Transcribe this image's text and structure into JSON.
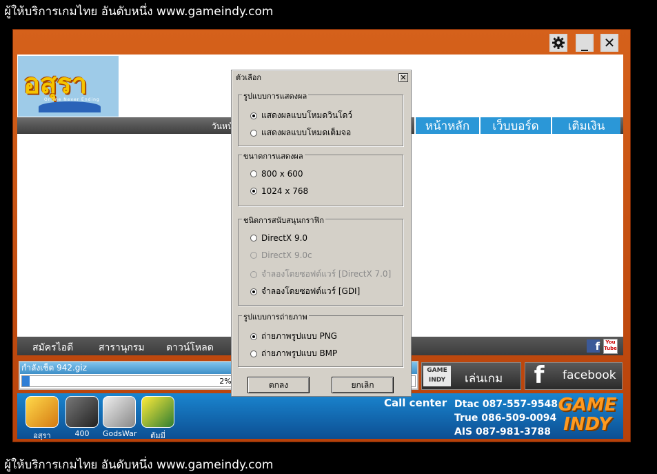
{
  "caption": "ผู้ให้บริการเกมไทย อันดับหนึ่ง www.gameindy.com",
  "titlebar": {
    "settings_icon": "gear-icon",
    "minimize_glyph": "_",
    "close_glyph": "✕"
  },
  "logo": {
    "title": "อสุรา",
    "subtitle": "Online Never Ending"
  },
  "nav": {
    "date_prefix": "วันหน้",
    "home": "หน้าหลัก",
    "board": "เว็บบอร์ด",
    "topup": "เติมเงิน"
  },
  "bottom_nav": {
    "register": "สมัครไอดี",
    "help": "สารานุกรม",
    "download": "ดาวน์โหลด",
    "facebook_glyph": "f",
    "youtube": "You Tube"
  },
  "status": {
    "text": "กำลังเช็ต 942.giz",
    "progress_label": "2%",
    "progress_fraction": 0.02
  },
  "play": {
    "label": "เล่นเกม",
    "logo": "GAME INDY"
  },
  "facebook": {
    "label": "facebook",
    "glyph": "f"
  },
  "banner": {
    "games": [
      {
        "name": "อสุรา"
      },
      {
        "name": "400"
      },
      {
        "name": "GodsWar"
      },
      {
        "name": "ตัมมี่"
      }
    ],
    "callcenter": "Call center",
    "phones": {
      "dtac": "Dtac  087-557-9548",
      "true": "True  086-509-0094",
      "ais": "AIS   087-981-3788"
    },
    "logo": "GAME INDY"
  },
  "dialog": {
    "title": "ตัวเลือก",
    "close_glyph": "✕",
    "groups": {
      "mode": {
        "title": "รูปแบบการแสดงผล",
        "options": [
          {
            "label": "แสดงผลแบบโหมดวินโดว์",
            "checked": true
          },
          {
            "label": "แสดงผลแบบโหมดเต็มจอ",
            "checked": false
          }
        ]
      },
      "res": {
        "title": "ขนาดการแสดงผล",
        "options": [
          {
            "label": "800 x 600",
            "checked": false
          },
          {
            "label": "1024 x 768",
            "checked": true
          }
        ]
      },
      "render": {
        "title": "ชนิดการสนับสนุนกราฟิก",
        "options": [
          {
            "label": "DirectX 9.0",
            "checked": false,
            "disabled": false
          },
          {
            "label": "DirectX 9.0c",
            "checked": false,
            "disabled": true
          },
          {
            "label": "จำลองโดยซอฟต์แวร์ [DirectX 7.0]",
            "checked": false,
            "disabled": true
          },
          {
            "label": "จำลองโดยซอฟต์แวร์ [GDI]",
            "checked": true,
            "disabled": false
          }
        ]
      },
      "shot": {
        "title": "รูปแบบการถ่ายภาพ",
        "options": [
          {
            "label": "ถ่ายภาพรูปแบบ PNG",
            "checked": true
          },
          {
            "label": "ถ่ายภาพรูปแบบ BMP",
            "checked": false
          }
        ]
      }
    },
    "ok": "ตกลง",
    "cancel": "ยกเลิก"
  }
}
